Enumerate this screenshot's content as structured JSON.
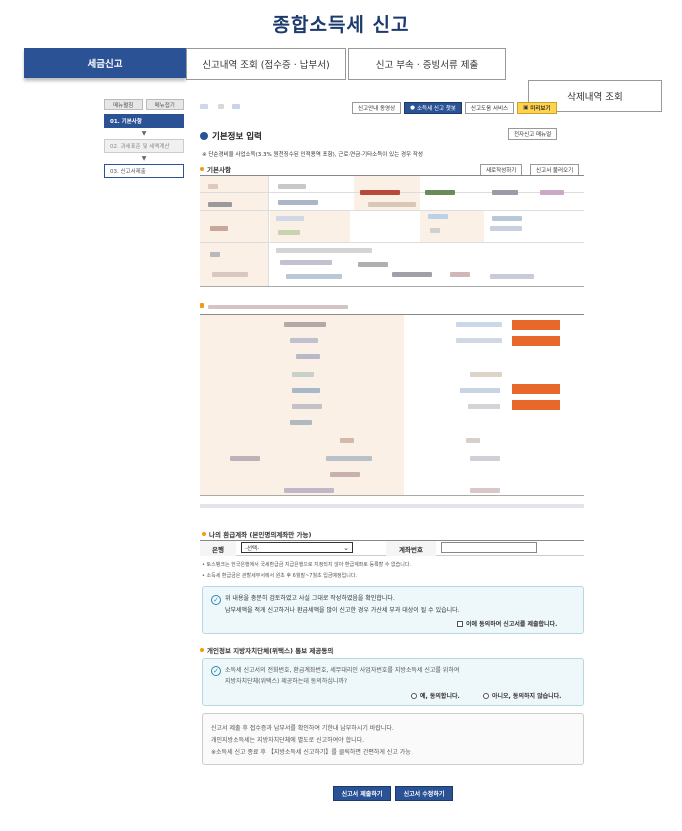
{
  "page": {
    "title": "종합소득세 신고"
  },
  "tabs": [
    {
      "label": "세금신고"
    },
    {
      "label": "신고내역 조회 (접수증 · 납부서)"
    },
    {
      "label": "신고 부속 · 증빙서류 제출"
    },
    {
      "label": "삭제내역 조회"
    }
  ],
  "sidebar": {
    "top_buttons": [
      "메뉴펼침",
      "메뉴접기"
    ],
    "steps": [
      {
        "label": "01. 기본사항"
      },
      {
        "label": "02. 과세표준 및 세액계산"
      },
      {
        "label": "03. 신고서제출"
      }
    ]
  },
  "toolbar": {
    "buttons": [
      "신고안내 동영상",
      "소득세 신고 챗봇",
      "신고도움 서비스",
      "미리보기"
    ]
  },
  "main": {
    "section_title": "기본정보 입력",
    "manual_button": "전자신고 매뉴얼",
    "note": "※ 단순경비율 사업소득(3.3% 원천징수된 인적용역 포함), 근로·연금·기타소득이 있는 경우 작성",
    "basic_head": "기본사항",
    "new_button": "새로작성하기",
    "load_button": "신고서 불러오기"
  },
  "refund": {
    "head": "나의 환급계좌 (본인명의계좌만 가능)",
    "bank_label": "은행",
    "bank_value": "-선택-",
    "account_label": "계좌번호",
    "account_value": "",
    "notes": [
      "• 토스뱅크는 한국은행에서 국세환급금 지급은행으로 지정되지 않아 환급계좌로 등록할 수 없습니다.",
      "• 소득세 환급금은 관할세무서에서 원초 후 6월말~7월초 입금예정입니다."
    ]
  },
  "agree_box": {
    "line1": "위 내용을 충분히 검토하였고 사실 그대로 작성하였음을 확인합니다.",
    "line2": "납부세액을 적게 신고하거나 환급세액을 많이 신고한 경우 가산세 부과 대상이 될 수 있습니다.",
    "checkbox": "이에 동의하여 신고서를 제출합니다."
  },
  "privacy": {
    "head": "개인정보 지방자치단체(위택스) 통보 제공동의",
    "line1": "소득세 신고서의 전화번호, 환급계좌번호, 세무대리인 사업자번호를 지방소득세 신고를 위하여",
    "line2": "지방자치단체(위택스) 제공하는데 동의하십니까?",
    "yes": "예, 동의합니다.",
    "no": "아니오, 동의하지 않습니다."
  },
  "notice": {
    "line1": "신고서 제출 후 접수증과 납부서를 확인하여 기한내 납부하시기 바랍니다.",
    "line2": "개인지방소득세는 지방자치단체에 별도로 신고하여야 합니다.",
    "line3": "※소득세 신고 종료 후 【지방소득세 신고하기】를 클릭하면 간편하게 신고 가능"
  },
  "bottom_buttons": [
    "신고서 제출하기",
    "신고서 수정하기"
  ],
  "colors": {
    "primary": "#2a5294",
    "orange": "#e8682a",
    "highlight": "#ffd34e"
  }
}
